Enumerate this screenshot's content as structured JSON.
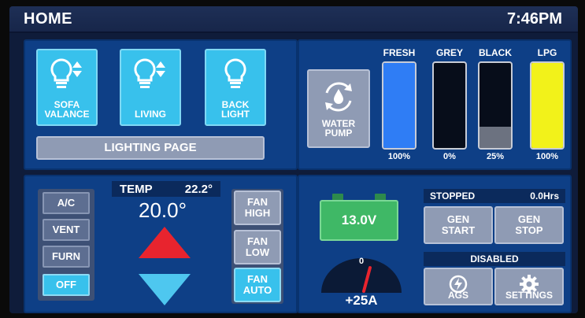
{
  "topbar": {
    "title": "HOME",
    "clock": "7:46PM"
  },
  "lighting": {
    "buttons": [
      {
        "label": "SOFA\nVALANCE",
        "icon": "bulb-dimmer-icon"
      },
      {
        "label": "LIVING",
        "icon": "bulb-dimmer-icon"
      },
      {
        "label": "BACK\nLIGHT",
        "icon": "bulb-icon"
      }
    ],
    "page_button": "LIGHTING PAGE"
  },
  "tanks": {
    "pump_label": "WATER\nPUMP",
    "pump_icon": "water-pump-icon",
    "items": [
      {
        "name": "FRESH",
        "percent": "100%",
        "level": 1.0,
        "color": "#2f7df5"
      },
      {
        "name": "GREY",
        "percent": "0%",
        "level": 0.0,
        "color": "#8a8f99"
      },
      {
        "name": "BLACK",
        "percent": "25%",
        "level": 0.25,
        "color": "#6c7280"
      },
      {
        "name": "LPG",
        "percent": "100%",
        "level": 1.0,
        "color": "#f2f21a"
      }
    ]
  },
  "climate": {
    "modes": [
      "A/C",
      "VENT",
      "FURN",
      "OFF"
    ],
    "active_mode": "OFF",
    "temp_label": "TEMP",
    "temp_current": "22.2°",
    "setpoint": "20.0°",
    "fan": [
      "FAN\nHIGH",
      "FAN\nLOW",
      "FAN\nAUTO"
    ],
    "active_fan": "FAN AUTO"
  },
  "power": {
    "battery_voltage": "13.0V",
    "gauge_zero": "0",
    "amps": "+25A",
    "gen_status": "STOPPED",
    "gen_hours": "0.0Hrs",
    "gen_start": "GEN\nSTART",
    "gen_stop": "GEN\nSTOP",
    "ags_status": "DISABLED",
    "ags_label": "AGS",
    "settings_label": "SETTINGS"
  },
  "colors": {
    "accent_cyan": "#38c1ec",
    "panel_blue": "#0e3f86",
    "battery_green": "#3fb866",
    "alert_red": "#e8242e"
  }
}
